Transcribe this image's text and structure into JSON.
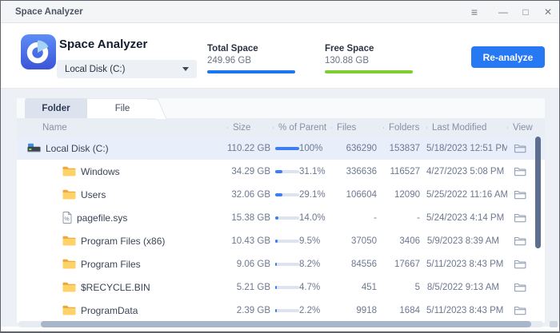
{
  "titlebar": {
    "title": "Space Analyzer",
    "icons": {
      "menu": "≡",
      "minimize": "—",
      "maximize": "□",
      "close": "✕"
    }
  },
  "header": {
    "app_title": "Space Analyzer",
    "drive_selector": {
      "value": "Local Disk (C:)"
    },
    "total_space": {
      "label": "Total Space",
      "value": "249.96 GB",
      "bar_color": "#1a76f2"
    },
    "free_space": {
      "label": "Free Space",
      "value": "130.88 GB",
      "bar_color": "#7fce2f"
    },
    "reanalyze_label": "Re-analyze"
  },
  "tabs": [
    {
      "label": "Folder",
      "active": true
    },
    {
      "label": "File",
      "active": false
    }
  ],
  "table": {
    "columns": [
      {
        "key": "name",
        "label": "Name"
      },
      {
        "key": "size",
        "label": "Size"
      },
      {
        "key": "percent",
        "label": "% of Parent"
      },
      {
        "key": "files",
        "label": "Files"
      },
      {
        "key": "folders",
        "label": "Folders"
      },
      {
        "key": "modified",
        "label": "Last Modified"
      },
      {
        "key": "view",
        "label": "View"
      }
    ],
    "rows": [
      {
        "name": "Local Disk (C:)",
        "icon": "drive-icon",
        "level": 0,
        "selected": true,
        "size": "110.22 GB",
        "percent": "100%",
        "percent_value": 100,
        "files": "636290",
        "folders": "153837",
        "modified": "5/18/2023 12:51 PM"
      },
      {
        "name": "Windows",
        "icon": "folder-icon",
        "level": 1,
        "selected": false,
        "size": "34.29 GB",
        "percent": "31.1%",
        "percent_value": 31.1,
        "files": "336636",
        "folders": "116527",
        "modified": "4/27/2023 5:08 PM"
      },
      {
        "name": "Users",
        "icon": "folder-icon",
        "level": 1,
        "selected": false,
        "size": "32.06 GB",
        "percent": "29.1%",
        "percent_value": 29.1,
        "files": "106604",
        "folders": "12090",
        "modified": "5/25/2022 11:16 AM"
      },
      {
        "name": "pagefile.sys",
        "icon": "file-icon",
        "level": 1,
        "selected": false,
        "size": "15.38 GB",
        "percent": "14.0%",
        "percent_value": 14.0,
        "files": "-",
        "folders": "-",
        "modified": "5/24/2023 4:14 PM"
      },
      {
        "name": "Program Files (x86)",
        "icon": "folder-icon",
        "level": 1,
        "selected": false,
        "size": "10.43 GB",
        "percent": "9.5%",
        "percent_value": 9.5,
        "files": "37050",
        "folders": "3406",
        "modified": "5/9/2023 8:39 AM"
      },
      {
        "name": "Program Files",
        "icon": "folder-icon",
        "level": 1,
        "selected": false,
        "size": "9.06 GB",
        "percent": "8.2%",
        "percent_value": 8.2,
        "files": "84556",
        "folders": "17667",
        "modified": "5/11/2023 8:43 PM"
      },
      {
        "name": "$RECYCLE.BIN",
        "icon": "folder-icon",
        "level": 1,
        "selected": false,
        "size": "5.21 GB",
        "percent": "4.7%",
        "percent_value": 4.7,
        "files": "451",
        "folders": "5",
        "modified": "8/5/2022 9:13 AM"
      },
      {
        "name": "ProgramData",
        "icon": "folder-icon",
        "level": 1,
        "selected": false,
        "size": "2.39 GB",
        "percent": "2.2%",
        "percent_value": 2.2,
        "files": "9918",
        "folders": "1684",
        "modified": "5/11/2023 8:43 PM"
      }
    ]
  },
  "colors": {
    "accent_blue": "#2678f3",
    "bar_fill": "#3f7ef2",
    "total_bar": "#1a76f2",
    "free_bar": "#7fce2f",
    "selected_row": "#e8effb"
  }
}
